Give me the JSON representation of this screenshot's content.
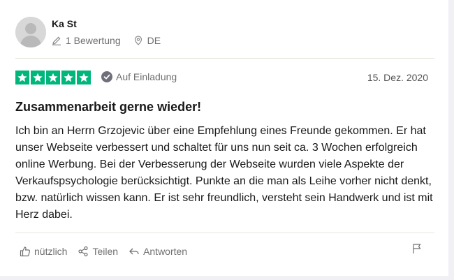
{
  "reviewer": {
    "name": "Ka St",
    "review_count": "1 Bewertung",
    "country": "DE"
  },
  "rating": {
    "stars": 5,
    "color": "#00b67a"
  },
  "badge": {
    "label": "Auf Einladung"
  },
  "date": "15. Dez. 2020",
  "review": {
    "title": "Zusammenarbeit gerne wieder!",
    "text": "Ich bin an Herrn Grzojevic über eine Empfehlung eines Freunde gekommen. Er hat unser Webseite verbessert und schaltet für uns nun seit ca. 3 Wochen erfolgreich online Werbung. Bei der Verbesserung der Webseite wurden viele Aspekte der Verkaufspsychologie berücksichtigt. Punkte an die man als Leihe vorher nicht denkt, bzw. natürlich wissen kann. Er ist sehr freundlich, versteht sein Handwerk und ist mit Herz dabei."
  },
  "actions": {
    "useful": "nützlich",
    "share": "Teilen",
    "reply": "Antworten"
  },
  "icons": [
    "avatar",
    "pencil-icon",
    "location-pin-icon",
    "star-icon",
    "check-circle-icon",
    "thumbs-up-icon",
    "share-icon",
    "reply-icon",
    "flag-icon"
  ]
}
